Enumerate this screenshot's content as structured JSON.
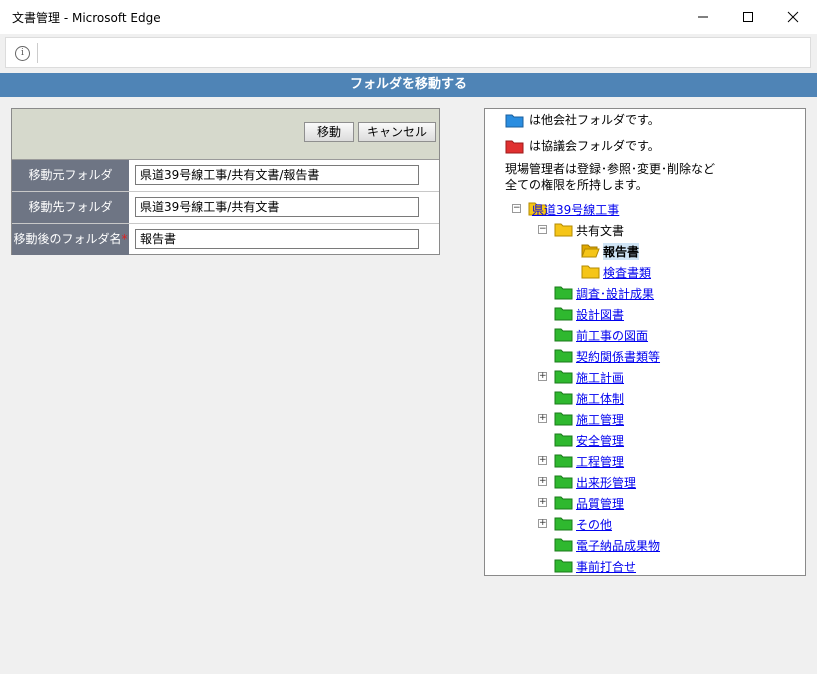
{
  "window": {
    "title": "文書管理 - Microsoft Edge",
    "controls": {
      "minimize": "—",
      "maximize": "☐",
      "close": "✕"
    }
  },
  "address_bar": {
    "info_icon": "i",
    "url": ""
  },
  "page": {
    "heading": "フォルダを移動する",
    "buttons": {
      "move": "移動",
      "cancel": "キャンセル"
    },
    "form": {
      "source_label": "移動元フォルダ",
      "source_value": "県道39号線工事/共有文書/報告書",
      "dest_label": "移動先フォルダ",
      "dest_value": "県道39号線工事/共有文書",
      "newname_label": "移動後のフォルダ名",
      "newname_required": "*",
      "newname_value": "報告書"
    }
  },
  "tree": {
    "legend_other": "は他会社フォルダです。",
    "legend_council": "は協議会フォルダです。",
    "note_line1": "現場管理者は登録･参照･変更･削除など",
    "note_line2": "全ての権限を所持します。",
    "nodes": [
      {
        "label": "県道39号線工事",
        "toggle": "−"
      },
      {
        "label": "共有文書",
        "toggle": "−"
      },
      {
        "label": "報告書"
      },
      {
        "label": "検査書類"
      },
      {
        "label": "調査･設計成果"
      },
      {
        "label": "設計図書"
      },
      {
        "label": "前工事の図面"
      },
      {
        "label": "契約関係書類等"
      },
      {
        "label": "施工計画",
        "toggle": "+"
      },
      {
        "label": "施工体制"
      },
      {
        "label": "施工管理",
        "toggle": "+"
      },
      {
        "label": "安全管理"
      },
      {
        "label": "工程管理",
        "toggle": "+"
      },
      {
        "label": "出来形管理",
        "toggle": "+"
      },
      {
        "label": "品質管理",
        "toggle": "+"
      },
      {
        "label": "その他",
        "toggle": "+"
      },
      {
        "label": "電子納品成果物"
      },
      {
        "label": "事前打合せ"
      }
    ]
  },
  "colors": {
    "header_bar": "#4f84b6",
    "label_bg": "#6e7584",
    "toolbar_bg": "#d6d9cc",
    "folder_yellow": "#f5c518",
    "folder_green": "#2fb82f",
    "folder_blue": "#2a8de0",
    "folder_red": "#e03030"
  }
}
